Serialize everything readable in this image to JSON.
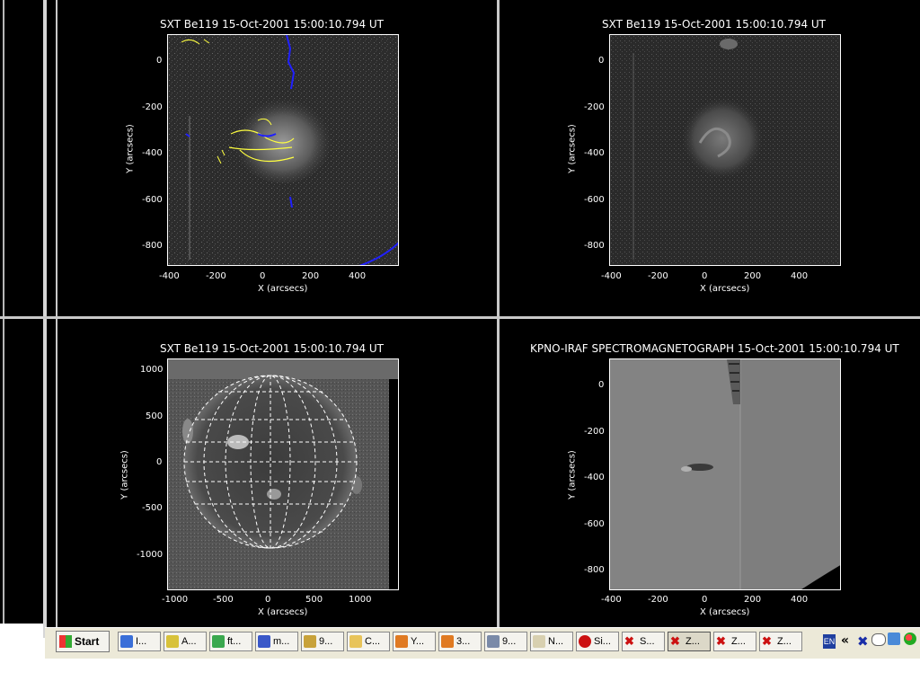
{
  "panels": {
    "tl": {
      "title": "SXT Be119  15-Oct-2001 15:00:10.794 UT",
      "yticks": [
        "0",
        "-200",
        "-400",
        "-600",
        "-800"
      ],
      "xticks": [
        "-400",
        "-200",
        "0",
        "200",
        "400"
      ],
      "xlabel": "X (arcsecs)",
      "ylabel": "Y (arcsecs)"
    },
    "tr": {
      "title": "SXT Be119  15-Oct-2001 15:00:10.794 UT",
      "yticks": [
        "0",
        "-200",
        "-400",
        "-600",
        "-800"
      ],
      "xticks": [
        "-400",
        "-200",
        "0",
        "200",
        "400"
      ],
      "xlabel": "X (arcsecs)",
      "ylabel": "Y (arcsecs)"
    },
    "bl": {
      "title": "SXT Be119  15-Oct-2001 15:00:10.794 UT",
      "yticks": [
        "1000",
        "500",
        "0",
        "-500",
        "-1000"
      ],
      "xticks": [
        "-1000",
        "-500",
        "0",
        "500",
        "1000"
      ],
      "xlabel": "X (arcsecs)",
      "ylabel": "Y (arcsecs)"
    },
    "br": {
      "title": "KPNO-IRAF SPECTROMAGNETOGRAPH 15-Oct-2001 15:00:10.794 UT",
      "yticks": [
        "0",
        "-200",
        "-400",
        "-600",
        "-800"
      ],
      "xticks": [
        "-400",
        "-200",
        "0",
        "200",
        "400"
      ],
      "xlabel": "X (arcsecs)",
      "ylabel": "Y (arcsecs)"
    }
  },
  "taskbar": {
    "start_label": "Start",
    "buttons": [
      {
        "label": "I...",
        "icon": "ie-icon",
        "color": "#3a6fd8"
      },
      {
        "label": "A...",
        "icon": "app-icon",
        "color": "#d8c23a"
      },
      {
        "label": "ft...",
        "icon": "globe-icon",
        "color": "#3aa84e"
      },
      {
        "label": "m...",
        "icon": "network-icon",
        "color": "#3a58c8"
      },
      {
        "label": "9...",
        "icon": "tool-icon",
        "color": "#c8a23a"
      },
      {
        "label": "C...",
        "icon": "folder-icon",
        "color": "#e8c45a"
      },
      {
        "label": "Y...",
        "icon": "firefox-icon",
        "color": "#e07a22"
      },
      {
        "label": "3...",
        "icon": "firefox-icon",
        "color": "#e07a22"
      },
      {
        "label": "9...",
        "icon": "window-icon",
        "color": "#7a8aa8"
      },
      {
        "label": "N...",
        "icon": "document-icon",
        "color": "#d8d0b0"
      },
      {
        "label": "Si...",
        "icon": "record-icon",
        "color": "#cc1111"
      },
      {
        "label": "S...",
        "icon": "x-icon",
        "color": "#cc1111"
      },
      {
        "label": "Z...",
        "icon": "x-icon",
        "color": "#cc1111",
        "active": true
      },
      {
        "label": "Z...",
        "icon": "x-icon",
        "color": "#cc1111"
      },
      {
        "label": "Z...",
        "icon": "x-icon",
        "color": "#cc1111"
      }
    ],
    "lang": "EN",
    "chevron": "«"
  }
}
